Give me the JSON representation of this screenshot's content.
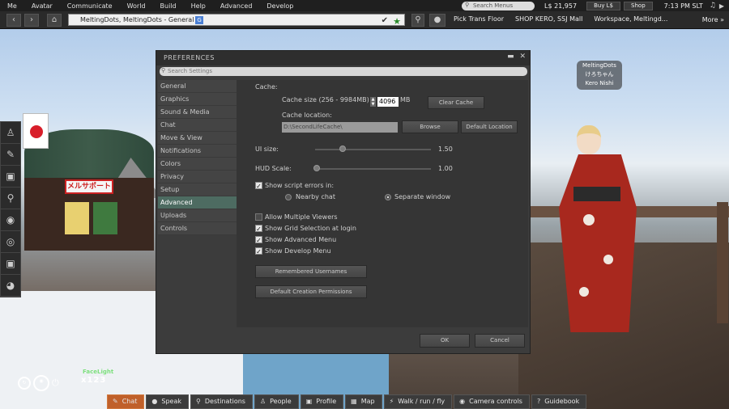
{
  "menubar": {
    "items": [
      "Me",
      "Avatar",
      "Communicate",
      "World",
      "Build",
      "Help",
      "Advanced",
      "Develop"
    ],
    "search_placeholder": "Search Menus",
    "balance": "L$ 21,957",
    "buy_label": "Buy L$",
    "shop_label": "Shop",
    "time": "7:13 PM SLT"
  },
  "navbar": {
    "location": "MeltingDots, MeltingDots - General",
    "rating_badge": "G",
    "favorites": [
      "Pick Trans Floor",
      "SHOP KERO, SSJ Mall",
      "Workspace, Meltingd..."
    ],
    "more_label": "More"
  },
  "nametag": {
    "line1": "MeltingDots",
    "line2": "けろちゃん",
    "line3": "Kero Nishi"
  },
  "scene": {
    "sign_text": "メルサポート"
  },
  "prefs": {
    "title": "PREFERENCES",
    "search_placeholder": "Search Settings",
    "categories": [
      "General",
      "Graphics",
      "Sound & Media",
      "Chat",
      "Move & View",
      "Notifications",
      "Colors",
      "Privacy",
      "Setup",
      "Advanced",
      "Uploads",
      "Controls"
    ],
    "selected_category": "Advanced",
    "cache_label": "Cache:",
    "cache_size_label": "Cache size (256 - 9984MB)",
    "cache_size_value": "4096",
    "cache_unit": "MB",
    "clear_cache": "Clear Cache",
    "cache_location_label": "Cache location:",
    "cache_location_value": "D:\\SecondLifeCache\\",
    "browse": "Browse",
    "default_location": "Default Location",
    "ui_size_label": "UI size:",
    "ui_size_value": "1.50",
    "hud_scale_label": "HUD Scale:",
    "hud_scale_value": "1.00",
    "show_script_errors": "Show script errors in:",
    "nearby_chat": "Nearby chat",
    "separate_window": "Separate window",
    "allow_multiple": "Allow Multiple Viewers",
    "show_grid_selection": "Show Grid Selection at login",
    "show_advanced_menu": "Show Advanced Menu",
    "show_develop_menu": "Show Develop Menu",
    "remembered_usernames": "Remembered Usernames",
    "default_creation_permissions": "Default Creation Permissions",
    "ok": "OK",
    "cancel": "Cancel"
  },
  "bottombar": {
    "buttons": [
      "Chat",
      "Speak",
      "Destinations",
      "People",
      "Profile",
      "Map",
      "Walk / run / fly",
      "Camera controls",
      "Guidebook"
    ]
  },
  "hud": {
    "title": "FaceLight",
    "controls": "x123"
  }
}
